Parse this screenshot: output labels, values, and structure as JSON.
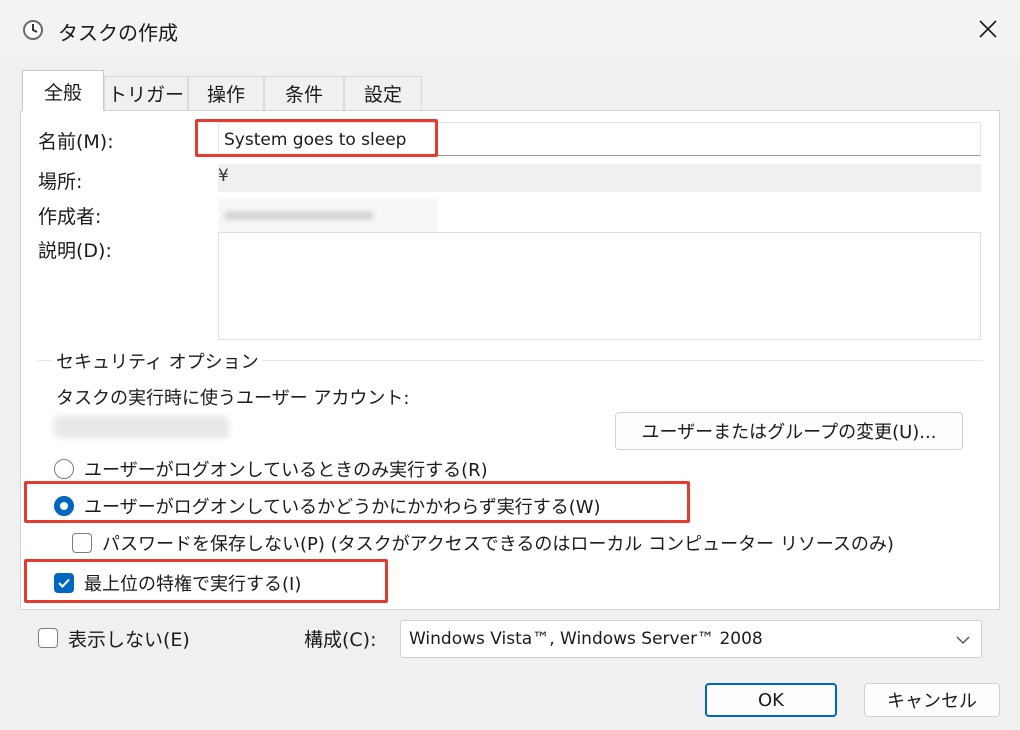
{
  "window": {
    "title": "タスクの作成",
    "icon": "clock-icon"
  },
  "tabs": [
    {
      "label": "全般",
      "active": true
    },
    {
      "label": "トリガー",
      "active": false
    },
    {
      "label": "操作",
      "active": false
    },
    {
      "label": "条件",
      "active": false
    },
    {
      "label": "設定",
      "active": false
    }
  ],
  "general": {
    "name_label": "名前(M):",
    "name_value": "System goes to sleep",
    "location_label": "場所:",
    "location_value": "¥",
    "author_label": "作成者:",
    "description_label": "説明(D):",
    "description_value": ""
  },
  "security": {
    "group_title": "セキュリティ オプション",
    "account_label": "タスクの実行時に使うユーザー アカウント:",
    "change_button": "ユーザーまたはグループの変更(U)...",
    "radio_logged_on_only": "ユーザーがログオンしているときのみ実行する(R)",
    "radio_whether_logged_on": "ユーザーがログオンしているかどうかにかかわらず実行する(W)",
    "selected_radio": "whether_logged_on",
    "no_password_label": "パスワードを保存しない(P) (タスクがアクセスできるのはローカル コンピューター リソースのみ)",
    "no_password_checked": false,
    "highest_privileges_label": "最上位の特権で実行する(I)",
    "highest_privileges_checked": true
  },
  "footer": {
    "hidden_label": "表示しない(E)",
    "hidden_checked": false,
    "configure_label": "構成(C):",
    "configure_value": "Windows Vista™, Windows Server™ 2008",
    "ok_label": "OK",
    "cancel_label": "キャンセル"
  },
  "colors": {
    "accent": "#0067c0",
    "highlight": "#e53a2e"
  }
}
